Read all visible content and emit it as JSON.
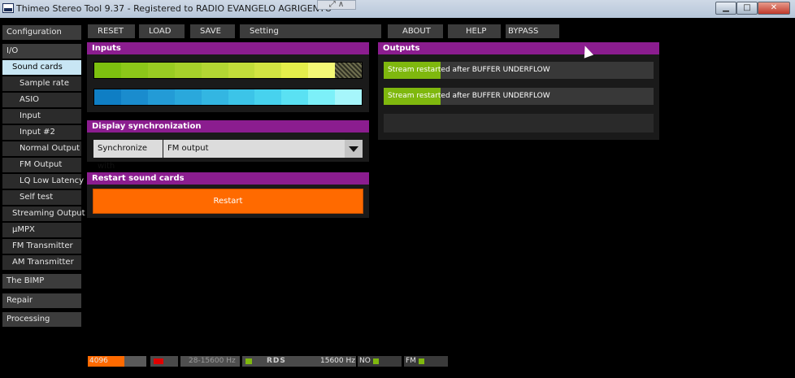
{
  "window": {
    "title": "Thimeo Stereo Tool 9.37 - Registered to RADIO EVANGELO AGRIGENTO",
    "min": "▁",
    "max": "□",
    "close": "✕"
  },
  "toolbar": {
    "reset": "RESET",
    "load": "LOAD",
    "save": "SAVE",
    "setting": "Setting",
    "about": "ABOUT",
    "help": "HELP",
    "bypass": "BYPASS"
  },
  "sidebar": {
    "configuration": "Configuration",
    "io": "I/O",
    "sound_cards": "Sound cards",
    "sample_rate": "Sample rate",
    "asio": "ASIO",
    "input": "Input",
    "input2": "Input #2",
    "normal_output": "Normal Output",
    "fm_output": "FM Output",
    "lq_low_latency": "LQ Low Latency",
    "self_test": "Self test",
    "streaming_output": "Streaming Output",
    "umpx": "µMPX",
    "fm_transmitter": "FM Transmitter",
    "am_transmitter": "AM Transmitter",
    "bimp": "The BIMP",
    "repair": "Repair",
    "processing": "Processing"
  },
  "inputs": {
    "title": "Inputs",
    "green_meter": [
      "#7dc10f",
      "#8cc719",
      "#99cc22",
      "#a6d12a",
      "#b3d633",
      "#c2dd3a",
      "#d2e442",
      "#e4ee4b",
      "#f4f876"
    ],
    "blue_meter": [
      "#0f7ec4",
      "#1a8cce",
      "#239bd6",
      "#2aa8dc",
      "#33b6e2",
      "#3cc4e8",
      "#47d2ee",
      "#5ae1f3",
      "#7cf0f9",
      "#a6f6fb"
    ]
  },
  "outputs": {
    "title": "Outputs",
    "rows": [
      {
        "text": "Stream restarted after BUFFER UNDERFLOW",
        "level": 0.21
      },
      {
        "text": "Stream restarted after BUFFER UNDERFLOW",
        "level": 0.21
      },
      {
        "text": "",
        "level": 0
      }
    ]
  },
  "sync": {
    "title": "Display synchronization",
    "label": "Synchronize with",
    "value": "FM output"
  },
  "restart": {
    "title": "Restart sound cards",
    "button": "Restart"
  },
  "statusbar": {
    "buffer": "4096",
    "buffer_level": 0.63,
    "range": "28-15600 Hz",
    "freq": "15600 Hz",
    "rds_label": "RDS",
    "no_label": "NO",
    "fm_label": "FM"
  },
  "colors": {
    "accent_header": "#8b1d8f",
    "restart": "#ff6a00",
    "meter_green": "#7fb80e"
  }
}
